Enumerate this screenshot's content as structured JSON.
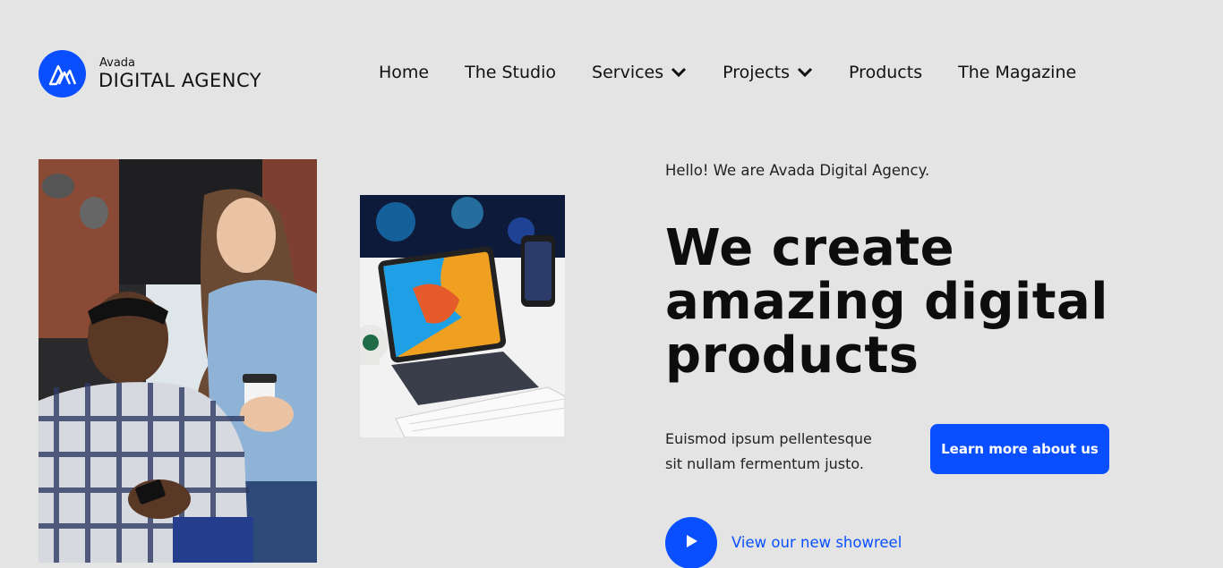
{
  "brand": {
    "small": "Avada",
    "big": "DIGITAL AGENCY",
    "accent": "#0a4fff"
  },
  "nav": {
    "items": [
      {
        "label": "Home",
        "dropdown": false
      },
      {
        "label": "The Studio",
        "dropdown": false
      },
      {
        "label": "Services",
        "dropdown": true
      },
      {
        "label": "Projects",
        "dropdown": true
      },
      {
        "label": "Products",
        "dropdown": false
      },
      {
        "label": "The Magazine",
        "dropdown": false
      }
    ]
  },
  "hero": {
    "intro": "Hello! We are Avada Digital Agency.",
    "headline": [
      "We create",
      "amazing digital",
      "products"
    ],
    "description": "Euismod ipsum pellentesque sit nullam fermentum justo.",
    "cta_label": "Learn more about us",
    "showreel_label": "View our new showreel"
  },
  "images": {
    "people": "photo-team-collaboration",
    "devices": "photo-tablet-phone-keyboard"
  },
  "icons": {
    "logo": "avada-logo-icon",
    "dropdown": "chevron-down-icon",
    "play": "play-icon"
  }
}
